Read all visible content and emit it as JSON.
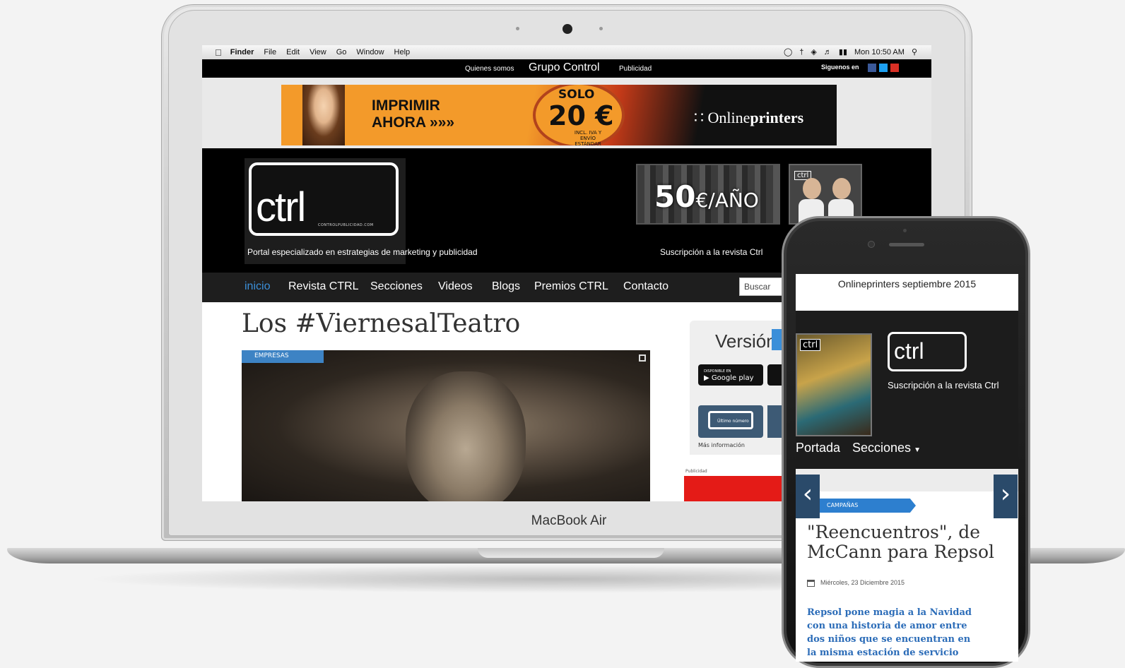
{
  "laptop": {
    "label": "MacBook Air",
    "menubar": {
      "items": [
        "Finder",
        "File",
        "Edit",
        "View",
        "Go",
        "Window",
        "Help"
      ],
      "clock": "Mon 10:50 AM"
    },
    "site": {
      "topbar": {
        "quienes": "Quienes somos",
        "grupo": "Grupo Control",
        "publicidad": "Publicidad",
        "siguenos": "Siguenos en"
      },
      "banner": {
        "imprimir": "IMPRIMIR",
        "ahora": "AHORA »»»",
        "solo": "SOLO",
        "price": "20 €",
        "inc": "INCL. IVA Y ENVÍO ESTÁNDAR",
        "brand_a": "Online",
        "brand_b": "printers"
      },
      "logo": {
        "text": "ctrl",
        "sub": "CONTROLPUBLICIDAD.COM"
      },
      "tagline": "Portal especializado en estrategias de marketing y publicidad",
      "ad50": {
        "big": "50",
        "small": "€/AÑO"
      },
      "ad_guys_label": "ctrl",
      "suscripcion": "Suscripción a la revista Ctrl",
      "nav": [
        {
          "label": "inicio",
          "active": true
        },
        {
          "label": "Revista CTRL"
        },
        {
          "label": "Secciones"
        },
        {
          "label": "Videos"
        },
        {
          "label": "Blogs"
        },
        {
          "label": "Premios  CTRL"
        },
        {
          "label": "Contacto"
        }
      ],
      "search_placeholder": "Buscar",
      "article": {
        "title": "Los #ViernesalTeatro",
        "tag": "EMPRESAS"
      },
      "sidebar": {
        "version": "Versión",
        "gplay_top": "DISPONIBLE EN",
        "gplay": "Google play",
        "ultimo": "Último número",
        "mas_info": "Más información",
        "publicidad": "Publicidad"
      }
    }
  },
  "phone": {
    "title": "Onlineprinters septiembre 2015",
    "cover_label": "ctrl",
    "logo": "ctrl",
    "suscripcion": "Suscripción a la revista Ctrl",
    "nav": [
      "Portada",
      "Secciones"
    ],
    "category": "CAMPAÑAS",
    "headline": "\"Reencuentros\", de McCann para Repsol",
    "date": "Miércoles, 23 Diciembre 2015",
    "excerpt": "Repsol pone magia a la Navidad con una historia de amor entre dos niños que se encuentran en la misma estación de servicio"
  }
}
